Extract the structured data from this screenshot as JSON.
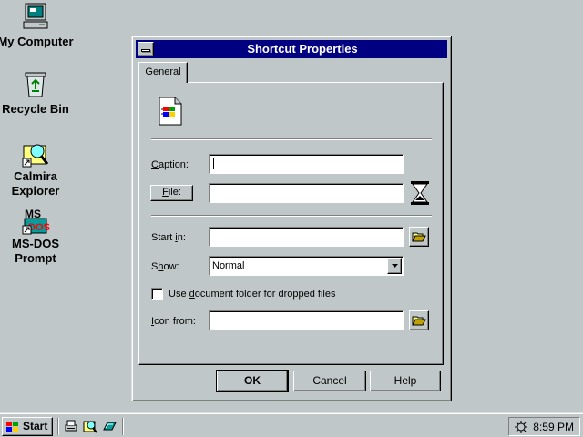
{
  "desktop": {
    "icons": [
      {
        "label": "My Computer",
        "icon": "computer-icon"
      },
      {
        "label": "Recycle Bin",
        "icon": "recycle-bin-icon"
      },
      {
        "label_line1": "Calmira",
        "label_line2": "Explorer",
        "icon": "explorer-icon"
      },
      {
        "label_line1": "MS-DOS",
        "label_line2": "Prompt",
        "icon": "msdos-icon"
      }
    ]
  },
  "dialog": {
    "title": "Shortcut Properties",
    "tab": "General",
    "caption": {
      "label_pre": "",
      "label_ul": "C",
      "label_post": "aption:",
      "value": ""
    },
    "file": {
      "label_pre": "",
      "label_ul": "F",
      "label_post": "ile:",
      "value": ""
    },
    "start_in": {
      "label_pre": "Start ",
      "label_ul": "i",
      "label_post": "n:",
      "value": ""
    },
    "show": {
      "label_pre": "S",
      "label_ul": "h",
      "label_post": "ow:",
      "value": "Normal"
    },
    "use_doc_folder": {
      "label_pre": "Use ",
      "label_ul": "d",
      "label_post": "ocument folder for dropped files",
      "checked": false
    },
    "icon_from": {
      "label_pre": "",
      "label_ul": "I",
      "label_post": "con from:",
      "value": ""
    },
    "buttons": {
      "ok": "OK",
      "cancel": "Cancel",
      "help": "Help"
    }
  },
  "taskbar": {
    "start_label": "Start",
    "clock": "8:59 PM"
  }
}
